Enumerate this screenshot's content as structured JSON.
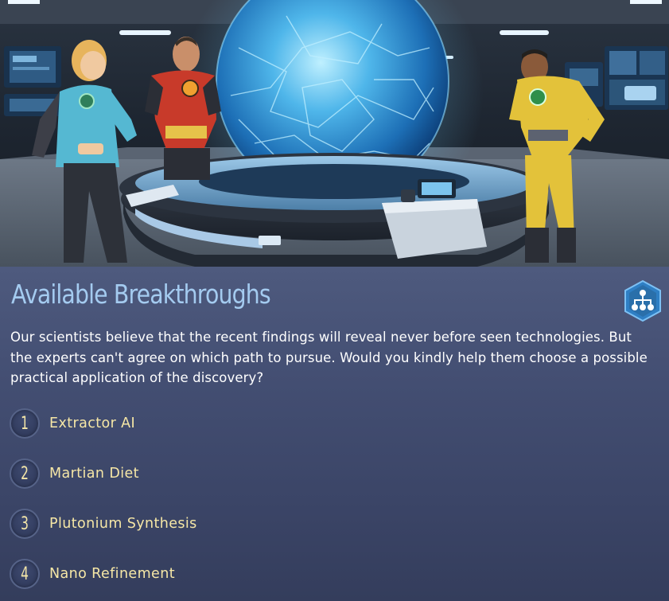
{
  "panel": {
    "title": "Available Breakthroughs",
    "research_icon": "research-tree-icon",
    "description": "Our scientists believe that the recent findings will reveal never before seen technologies. But the experts can't agree on which path to pursue. Would you kindly help them choose a possible practical application of the discovery?"
  },
  "options": [
    {
      "number": "1",
      "label": "Extractor AI"
    },
    {
      "number": "2",
      "label": "Martian Diet"
    },
    {
      "number": "3",
      "label": "Plutonium Synthesis"
    },
    {
      "number": "4",
      "label": "Nano Refinement"
    }
  ],
  "colors": {
    "title": "#a4cbf0",
    "option_text": "#f6e7a6",
    "panel_bg": "#434e72",
    "icon_hex": "#2f7fc4"
  },
  "illustration": {
    "scene": "science-lab-hologram-globe",
    "figures": [
      "scientist-cyan-suit",
      "scientist-red-suit",
      "scientist-yellow-suit"
    ]
  }
}
